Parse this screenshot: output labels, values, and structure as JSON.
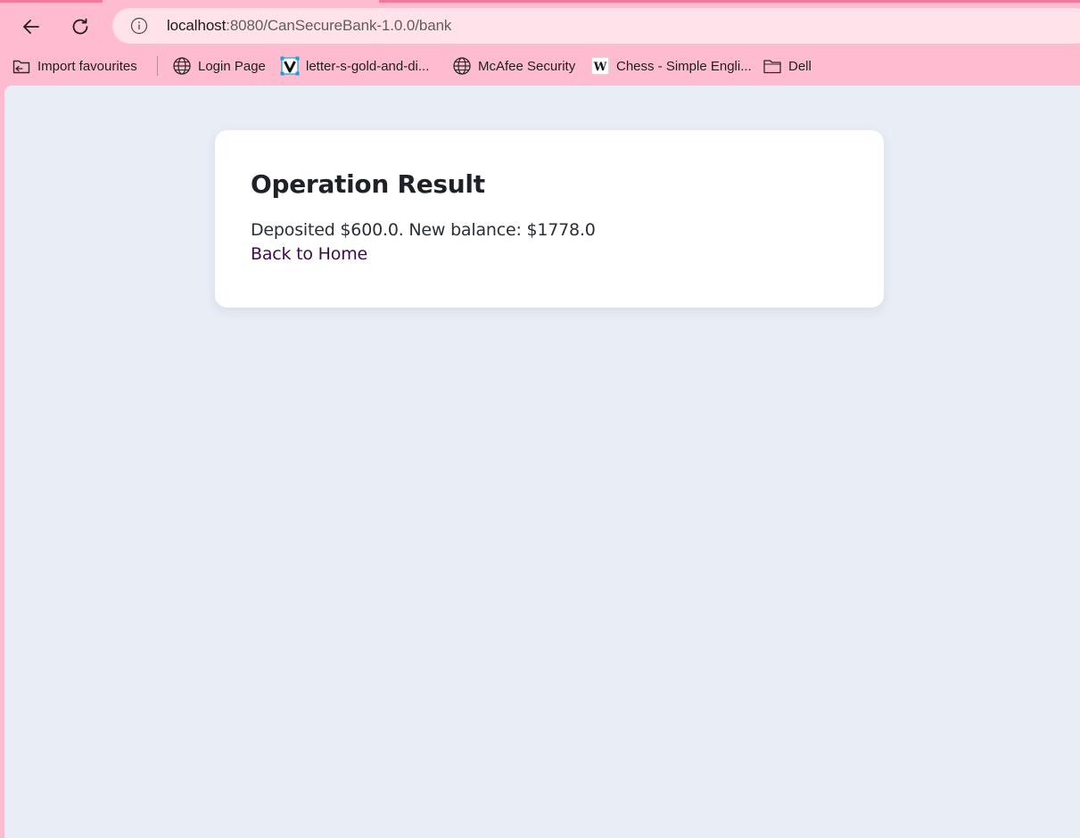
{
  "browser": {
    "url_host": "localhost",
    "url_rest": ":8080/CanSecureBank-1.0.0/bank",
    "bookmarks": [
      {
        "label": "Import favourites",
        "icon": "import-icon"
      },
      {
        "label": "Login Page",
        "icon": "globe-icon"
      },
      {
        "label": "letter-s-gold-and-di...",
        "icon": "image-logo-icon"
      },
      {
        "label": "McAfee Security",
        "icon": "globe-icon"
      },
      {
        "label": "Chess - Simple Engli...",
        "icon": "wikipedia-icon"
      },
      {
        "label": "Dell",
        "icon": "folder-icon"
      }
    ]
  },
  "page": {
    "title": "Operation Result",
    "message": "Deposited $600.0. New balance: $1778.0",
    "back_link": "Back to Home"
  },
  "colors": {
    "browser_chrome": "#ffbcd0",
    "address_bar": "#ffe2ea",
    "page_background": "#e9edf5",
    "card_background": "#ffffff",
    "link": "#3d0a4d"
  }
}
